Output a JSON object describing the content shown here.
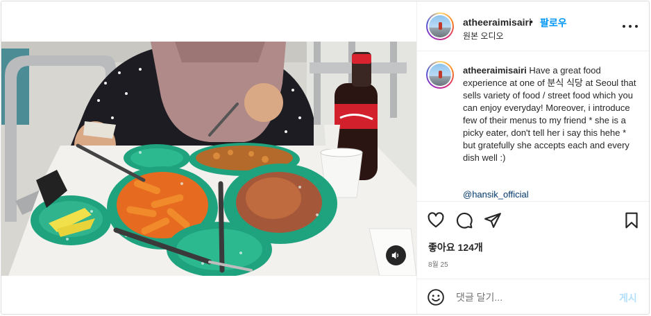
{
  "header": {
    "username": "atheeraimisairi",
    "separator": "•",
    "follow_label": "팔로우",
    "audio_label": "원본 오디오"
  },
  "caption": {
    "username": "atheeraimisairi",
    "text": " Have a great food experience at one of 분식 식당 at Seoul that sells variety of food / street food which you can enjoy everyday! Moreover, i introduce few of their menus to my friend * she is a picky eater, don't tell her i say this hehe * but gratefully she accepts each and every dish well :)",
    "mention": "@hansik_official"
  },
  "actions": {
    "icons": [
      "heart-icon",
      "comment-icon",
      "share-icon",
      "bookmark-icon"
    ],
    "likes": "좋아요 124개",
    "date": "8월 25"
  },
  "comment": {
    "placeholder": "댓글 달기...",
    "post_label": "게시"
  },
  "media": {
    "mute_icon": "speaker-icon"
  },
  "colors": {
    "accent": "#0095f6",
    "post_disabled": "#b2dffc",
    "text": "#262626",
    "muted": "#737373",
    "link": "#00376b",
    "bowl_green": "#1fa37f"
  }
}
